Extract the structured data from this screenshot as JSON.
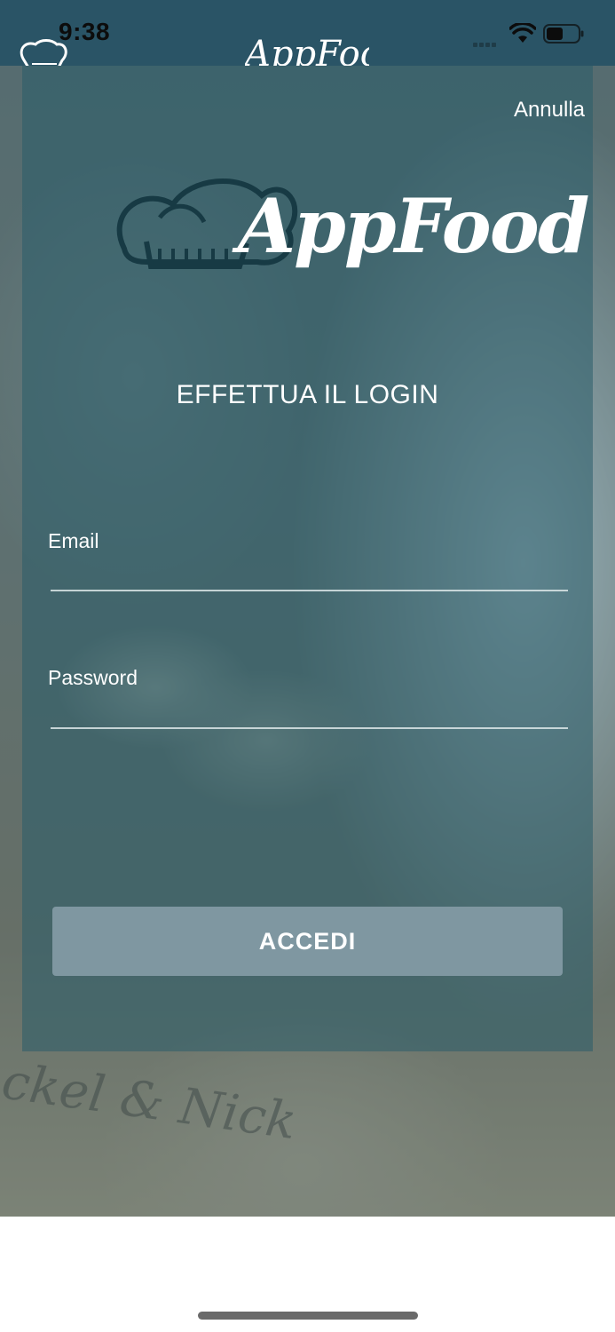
{
  "status_bar": {
    "time": "9:38"
  },
  "header": {
    "logo_text": "AppFood"
  },
  "login": {
    "cancel_label": "Annulla",
    "brand": "AppFood",
    "heading": "EFFETTUA IL LOGIN",
    "email_label": "Email",
    "email_value": "",
    "password_label": "Password",
    "password_value": "",
    "submit_label": "ACCEDI"
  },
  "background": {
    "photo_text": "ckel & Nick"
  },
  "colors": {
    "header_bg": "#2a5466",
    "panel_overlay": "#2a5c6a",
    "button_bg": "#7f97a1",
    "text": "#ffffff"
  },
  "icons": [
    "chef-hat-icon",
    "wifi-icon",
    "battery-icon",
    "signal-icon"
  ]
}
